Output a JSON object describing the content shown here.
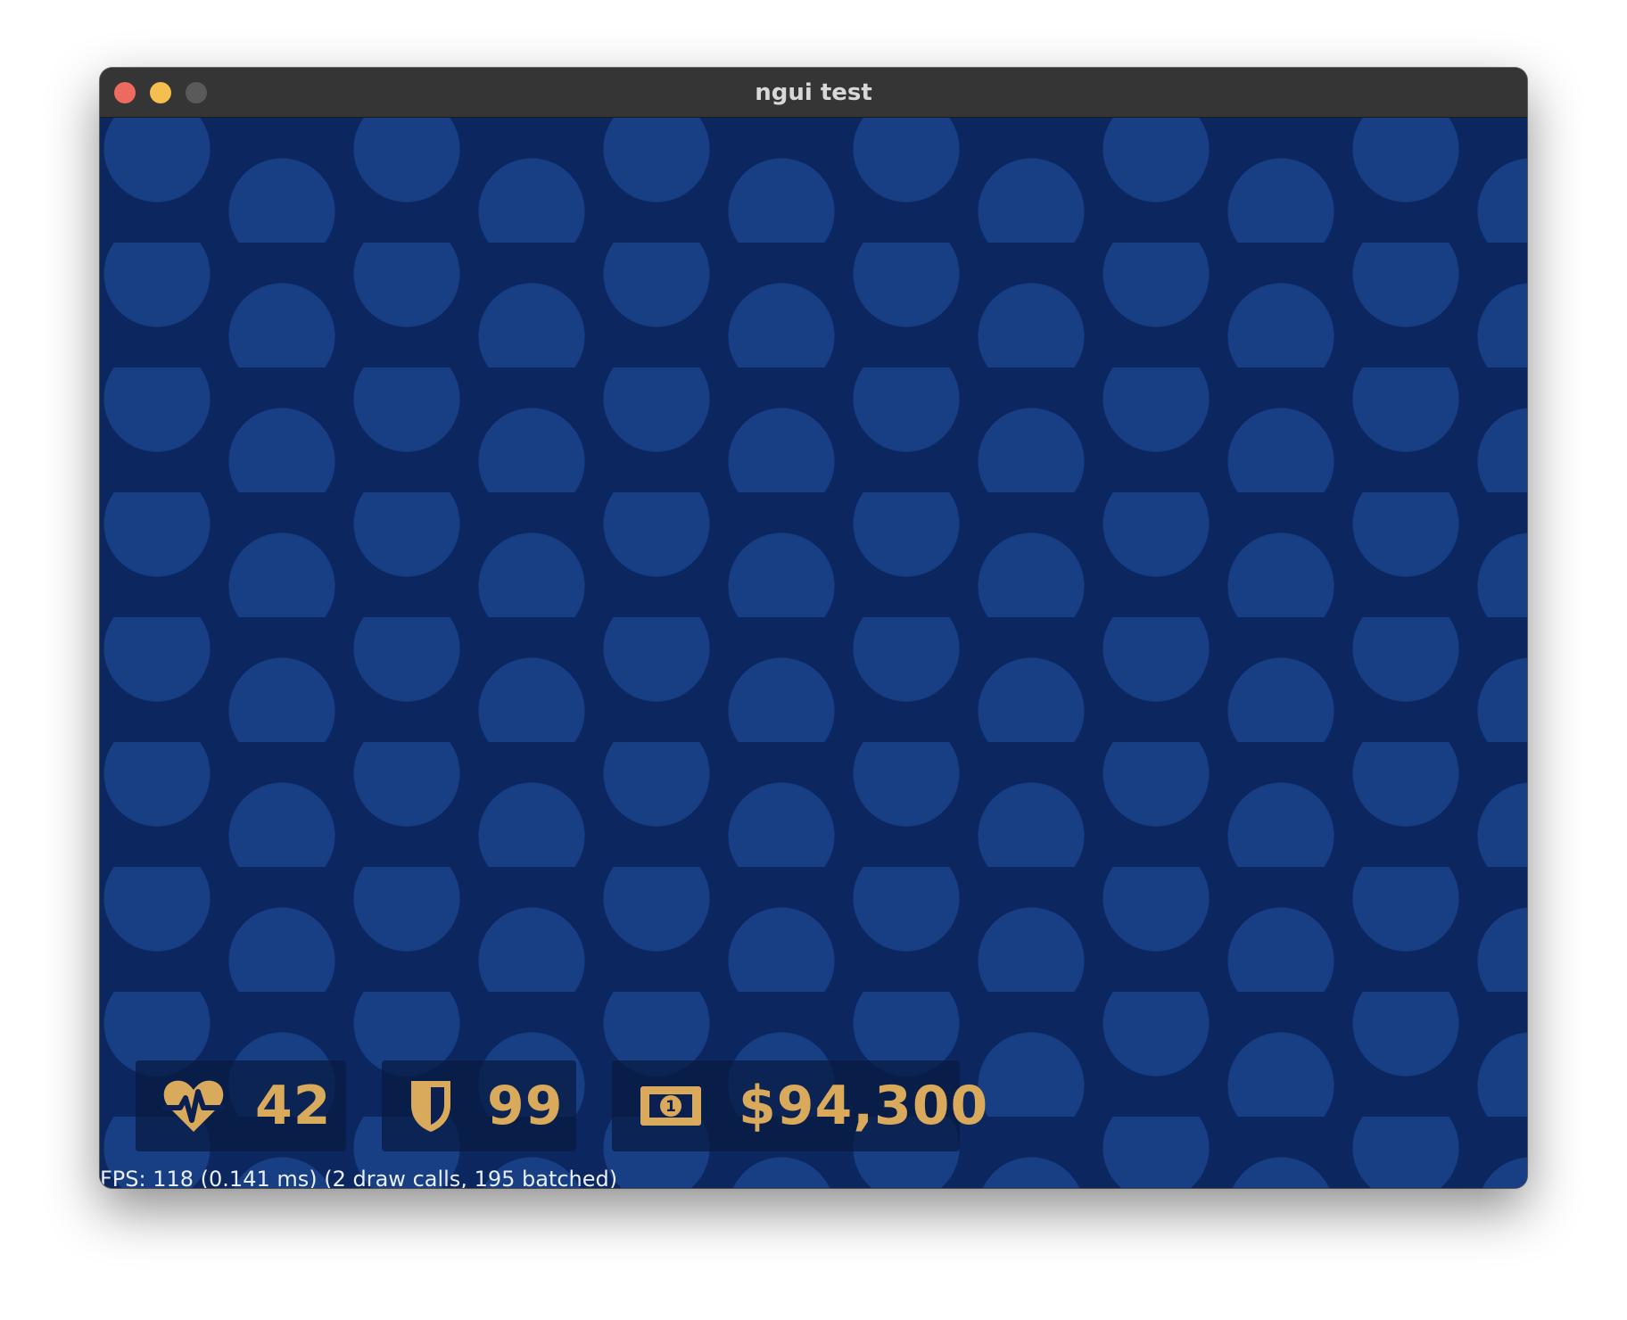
{
  "window": {
    "title": "ngui test"
  },
  "hud": {
    "health": {
      "icon": "heartbeat-icon",
      "value": "42"
    },
    "shield": {
      "icon": "shield-icon",
      "value": "99"
    },
    "money": {
      "icon": "banknote-icon",
      "value": "$94,300"
    }
  },
  "stats": {
    "fps_text": "FPS: 118 (0.141 ms) (2 draw calls, 195 batched)"
  },
  "colors": {
    "background": "#0c2660",
    "dots": "#183f84",
    "hud_text": "#d9a95c",
    "hud_panel": "#081a40"
  }
}
